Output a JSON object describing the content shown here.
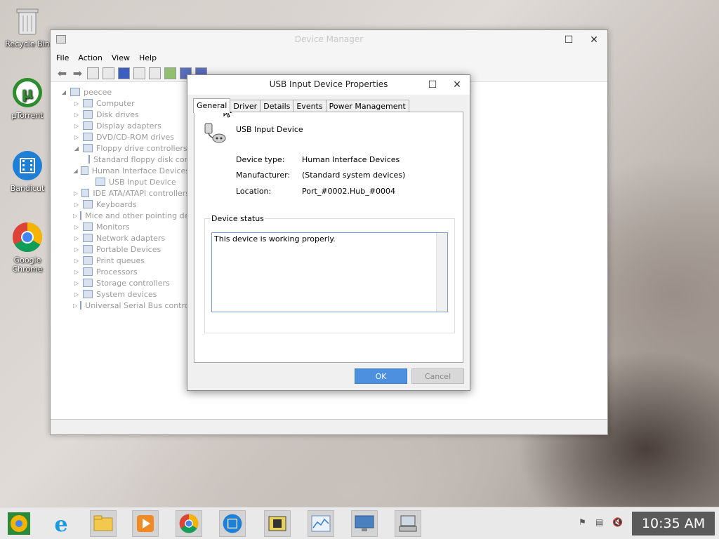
{
  "desktop": {
    "icons": [
      {
        "label": "Recycle Bin",
        "icon": "recycle-bin-icon"
      },
      {
        "label": "µTorrent",
        "icon": "utorrent-icon"
      },
      {
        "label": "Bandicut",
        "icon": "bandicut-icon"
      },
      {
        "label": "Google Chrome",
        "icon": "chrome-icon"
      }
    ]
  },
  "device_manager": {
    "title": "Device Manager",
    "menu": [
      "File",
      "Action",
      "View",
      "Help"
    ],
    "tree": [
      {
        "label": "peecee",
        "expand": "◢",
        "level": 0
      },
      {
        "label": "Computer",
        "expand": "▷",
        "level": 1
      },
      {
        "label": "Disk drives",
        "expand": "▷",
        "level": 1
      },
      {
        "label": "Display adapters",
        "expand": "▷",
        "level": 1
      },
      {
        "label": "DVD/CD-ROM drives",
        "expand": "▷",
        "level": 1
      },
      {
        "label": "Floppy drive controllers",
        "expand": "◢",
        "level": 1
      },
      {
        "label": "Standard floppy disk controller",
        "expand": "",
        "level": 2
      },
      {
        "label": "Human Interface Devices",
        "expand": "◢",
        "level": 1
      },
      {
        "label": "USB Input Device",
        "expand": "",
        "level": 2
      },
      {
        "label": "IDE ATA/ATAPI controllers",
        "expand": "▷",
        "level": 1
      },
      {
        "label": "Keyboards",
        "expand": "▷",
        "level": 1
      },
      {
        "label": "Mice and other pointing devices",
        "expand": "▷",
        "level": 1
      },
      {
        "label": "Monitors",
        "expand": "▷",
        "level": 1
      },
      {
        "label": "Network adapters",
        "expand": "▷",
        "level": 1
      },
      {
        "label": "Portable Devices",
        "expand": "▷",
        "level": 1
      },
      {
        "label": "Print queues",
        "expand": "▷",
        "level": 1
      },
      {
        "label": "Processors",
        "expand": "▷",
        "level": 1
      },
      {
        "label": "Storage controllers",
        "expand": "▷",
        "level": 1
      },
      {
        "label": "System devices",
        "expand": "▷",
        "level": 1
      },
      {
        "label": "Universal Serial Bus controllers",
        "expand": "▷",
        "level": 1
      }
    ]
  },
  "dialog": {
    "title": "USB Input Device Properties",
    "tabs": [
      "General",
      "Driver",
      "Details",
      "Events",
      "Power Management"
    ],
    "active_tab": "General",
    "device_name": "USB Input Device",
    "device_type_label": "Device type:",
    "device_type_value": "Human Interface Devices",
    "manufacturer_label": "Manufacturer:",
    "manufacturer_value": "(Standard system devices)",
    "location_label": "Location:",
    "location_value": "Port_#0002.Hub_#0004",
    "status_group_label": "Device status",
    "status_text": "This device is working properly.",
    "ok_label": "OK",
    "cancel_label": "Cancel",
    "maximize_glyph": "☐",
    "close_glyph": "✕"
  },
  "taskbar": {
    "clock": "10:35 AM"
  }
}
